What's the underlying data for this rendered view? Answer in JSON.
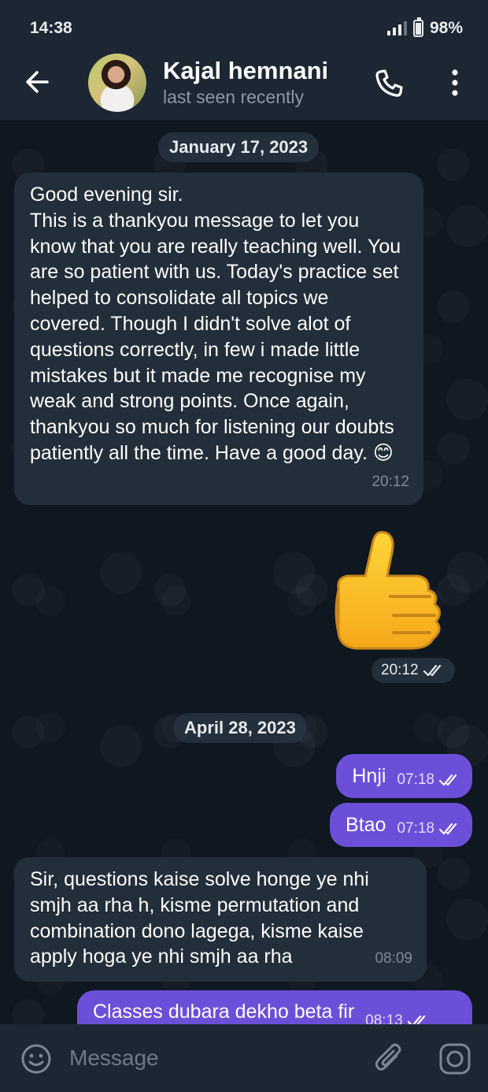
{
  "status_bar": {
    "time": "14:38",
    "battery": "98%"
  },
  "header": {
    "contact_name": "Kajal hemnani",
    "contact_status": "last seen recently",
    "icons": {
      "back": "back-arrow-icon",
      "call": "phone-icon",
      "more": "more-vertical-icon"
    }
  },
  "chat": {
    "date_1": "January 17, 2023",
    "message_1": {
      "text": "Good evening sir.\nThis is a thankyou message to let you know that you are really teaching well. You are so patient with us. Today's practice set helped to consolidate all topics we covered. Though I didn't solve alot of questions correctly, in few i made little mistakes but it made me recognise my weak and strong points. Once again, thankyou so much for listening our doubts patiently all the time. Have a good day. 😊",
      "time": "20:12"
    },
    "sticker": {
      "icon": "thumbs-up-sticker",
      "time": "20:12"
    },
    "date_2": "April 28, 2023",
    "message_2": {
      "text": "Hnji",
      "time": "07:18"
    },
    "message_3": {
      "text": "Btao",
      "time": "07:18"
    },
    "message_4": {
      "text": "Sir, questions kaise solve honge ye nhi smjh aa rha h, kisme permutation and combination dono lagega, kisme kaise apply hoga ye nhi smjh aa rha",
      "time": "08:09"
    },
    "message_5": {
      "text": "Classes dubara dekho beta fir",
      "time": "08:13"
    }
  },
  "input_bar": {
    "placeholder": "Message",
    "icons": {
      "emoji": "emoji-icon",
      "attach": "paperclip-icon",
      "camera": "camera-icon"
    }
  },
  "colors": {
    "background": "#0e1621",
    "header": "#1c2733",
    "incoming_bubble": "#222e3a",
    "outgoing_bubble": "#6c4fd8"
  }
}
